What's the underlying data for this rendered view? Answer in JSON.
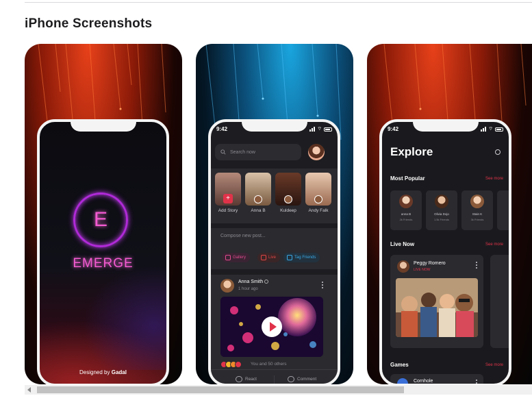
{
  "section": {
    "title": "iPhone Screenshots"
  },
  "screen1": {
    "logo_letter": "E",
    "brand": "EMERGE",
    "credit_prefix": "Designed by",
    "credit_name": "Gadal"
  },
  "screen2": {
    "time": "9:42",
    "search_placeholder": "Search now",
    "stories": [
      {
        "label": "Add Story"
      },
      {
        "label": "Anna B"
      },
      {
        "label": "Kuldeep"
      },
      {
        "label": "Andy Falk"
      }
    ],
    "compose_placeholder": "Compose new post...",
    "chips": {
      "gallery": "Gallery",
      "live": "Live",
      "tag": "Tag Friends"
    },
    "post": {
      "author": "Anna Smith",
      "time": "1 hour ago",
      "reactions_text": "You and 50 others",
      "react_label": "React",
      "comment_label": "Comment"
    }
  },
  "screen3": {
    "time": "9:42",
    "title": "Explore",
    "most_popular": "Most Popular",
    "see_more": "See more",
    "popular": [
      {
        "name": "anna B",
        "sub": "2k Friends"
      },
      {
        "name": "Olivia Dojo",
        "sub": "1.5k Friends"
      },
      {
        "name": "Stain K",
        "sub": "3k Friends"
      }
    ],
    "live_now": "Live Now",
    "live": {
      "name": "Peggy Romero",
      "tag": "LIVE NOW"
    },
    "games": "Games",
    "game": {
      "name": "Cornhole"
    }
  },
  "colors": {
    "accent_pink": "#f55ad2",
    "accent_red": "#e0334a",
    "accent_blue": "#3aa9e8",
    "card_dark": "#2a2a2f"
  }
}
